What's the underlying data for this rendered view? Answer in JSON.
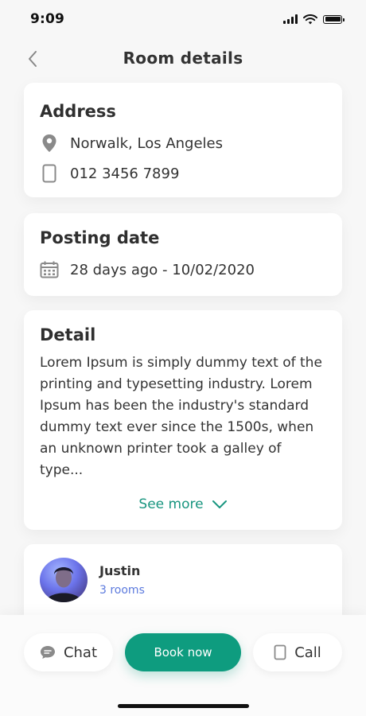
{
  "status_bar": {
    "time": "9:09"
  },
  "header": {
    "title": "Room details"
  },
  "address": {
    "title": "Address",
    "location": "Norwalk, Los Angeles",
    "phone": "012 3456 7899"
  },
  "posting": {
    "title": "Posting date",
    "date": "28 days ago - 10/02/2020"
  },
  "detail": {
    "title": "Detail",
    "text": "Lorem Ipsum is simply dummy text of the printing and typesetting industry. Lorem Ipsum has been the industry's standard dummy text ever since the 1500s, when an unknown printer took a galley of type...",
    "see_more": "See more"
  },
  "host": {
    "name": "Justin",
    "rooms": "3 rooms"
  },
  "actions": {
    "chat": "Chat",
    "book": "Book now",
    "call": "Call"
  },
  "colors": {
    "accent": "#0e9c7f",
    "link": "#5d7bde",
    "background": "#f7f7f7"
  },
  "icons": {
    "back": "chevron-left-icon",
    "location": "location-pin-icon",
    "phone": "phone-icon",
    "calendar": "calendar-icon",
    "see_more": "chevron-down-icon",
    "chat": "chat-bubble-icon",
    "call": "phone-icon"
  }
}
